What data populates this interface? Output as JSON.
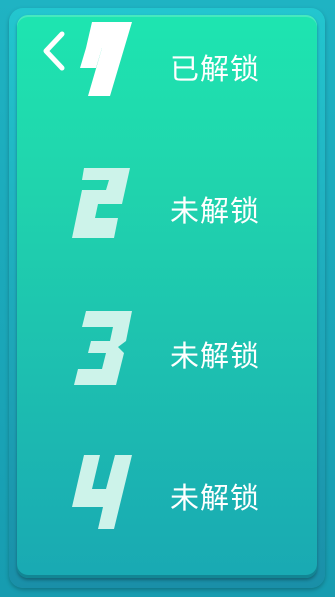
{
  "colors": {
    "panel_top": "#1ee5b0",
    "panel_bottom": "#19a9b3",
    "frame": "#1aa6b6",
    "unlocked_number": "#ffffff",
    "locked_number": "#cdf3ea",
    "status_text": "#ffffff"
  },
  "back_button": {
    "icon": "chevron-left-icon"
  },
  "levels": [
    {
      "number": "1",
      "status": "已解锁",
      "unlocked": true
    },
    {
      "number": "2",
      "status": "未解锁",
      "unlocked": false
    },
    {
      "number": "3",
      "status": "未解锁",
      "unlocked": false
    },
    {
      "number": "4",
      "status": "未解锁",
      "unlocked": false
    }
  ]
}
